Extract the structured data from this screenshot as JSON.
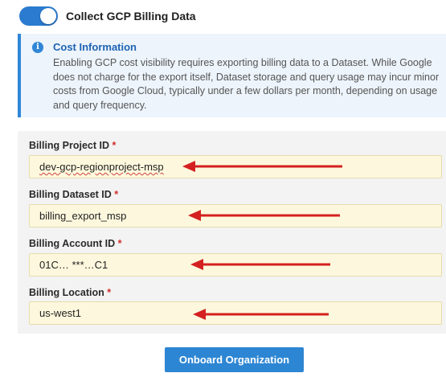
{
  "toggle": {
    "label": "Collect GCP Billing Data",
    "checked": true,
    "accent": "#2b7bd0"
  },
  "info": {
    "icon": "info-icon",
    "title": "Cost Information",
    "body": "Enabling GCP cost visibility requires exporting billing data to a Dataset. While Google does not charge for the export itself, Dataset storage and query usage may incur minor costs from Google Cloud, typically under a few dollars per month, depending on usage and query frequency."
  },
  "fields": [
    {
      "label": "Billing Project ID",
      "required": "*",
      "value": "dev-gcp-regionproject-msp"
    },
    {
      "label": "Billing Dataset ID",
      "required": "*",
      "value": "billing_export_msp"
    },
    {
      "label": "Billing Account ID",
      "required": "*",
      "value": "01C… ***…C1"
    },
    {
      "label": "Billing Location",
      "required": "*",
      "value": "us-west1"
    }
  ],
  "annotations": {
    "arrow_color": "#d42020"
  },
  "actions": {
    "onboard_label": "Onboard Organization"
  }
}
